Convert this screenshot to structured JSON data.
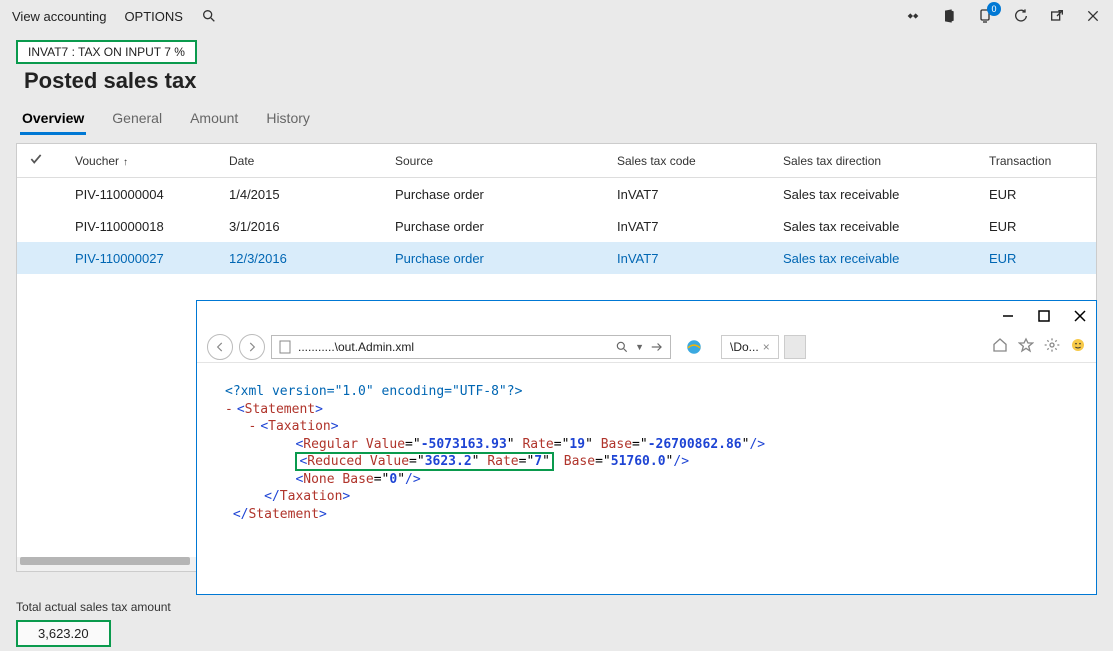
{
  "toolbar": {
    "view_accounting": "View accounting",
    "options": "OPTIONS",
    "notif_count": "0"
  },
  "context_badge": "INVAT7 : TAX ON INPUT 7 %",
  "page_title": "Posted sales tax",
  "tabs": {
    "overview": "Overview",
    "general": "General",
    "amount": "Amount",
    "history": "History"
  },
  "grid": {
    "headers": {
      "voucher": "Voucher",
      "date": "Date",
      "source": "Source",
      "code": "Sales tax code",
      "dir": "Sales tax direction",
      "cur": "Transaction"
    },
    "rows": [
      {
        "voucher": "PIV-110000004",
        "date": "1/4/2015",
        "source": "Purchase order",
        "code": "InVAT7",
        "dir": "Sales tax receivable",
        "cur": "EUR"
      },
      {
        "voucher": "PIV-110000018",
        "date": "3/1/2016",
        "source": "Purchase order",
        "code": "InVAT7",
        "dir": "Sales tax receivable",
        "cur": "EUR"
      },
      {
        "voucher": "PIV-110000027",
        "date": "12/3/2016",
        "source": "Purchase order",
        "code": "InVAT7",
        "dir": "Sales tax receivable",
        "cur": "EUR"
      }
    ]
  },
  "total": {
    "label": "Total actual sales tax amount",
    "value": "3,623.20"
  },
  "ie": {
    "address": "...........\\out.Admin.xml",
    "tab_title": "\\Do...",
    "xml": {
      "pi": "<?xml version=\"1.0\" encoding=\"UTF-8\"?>",
      "statement_o": "Statement",
      "taxation_o": "Taxation",
      "regular": {
        "tag": "Regular",
        "value": "-5073163.93",
        "rate": "19",
        "base": "-26700862.86"
      },
      "reduced": {
        "tag": "Reduced",
        "value": "3623.2",
        "rate": "7",
        "base": "51760.0"
      },
      "none": {
        "tag": "None",
        "base": "0"
      }
    }
  }
}
